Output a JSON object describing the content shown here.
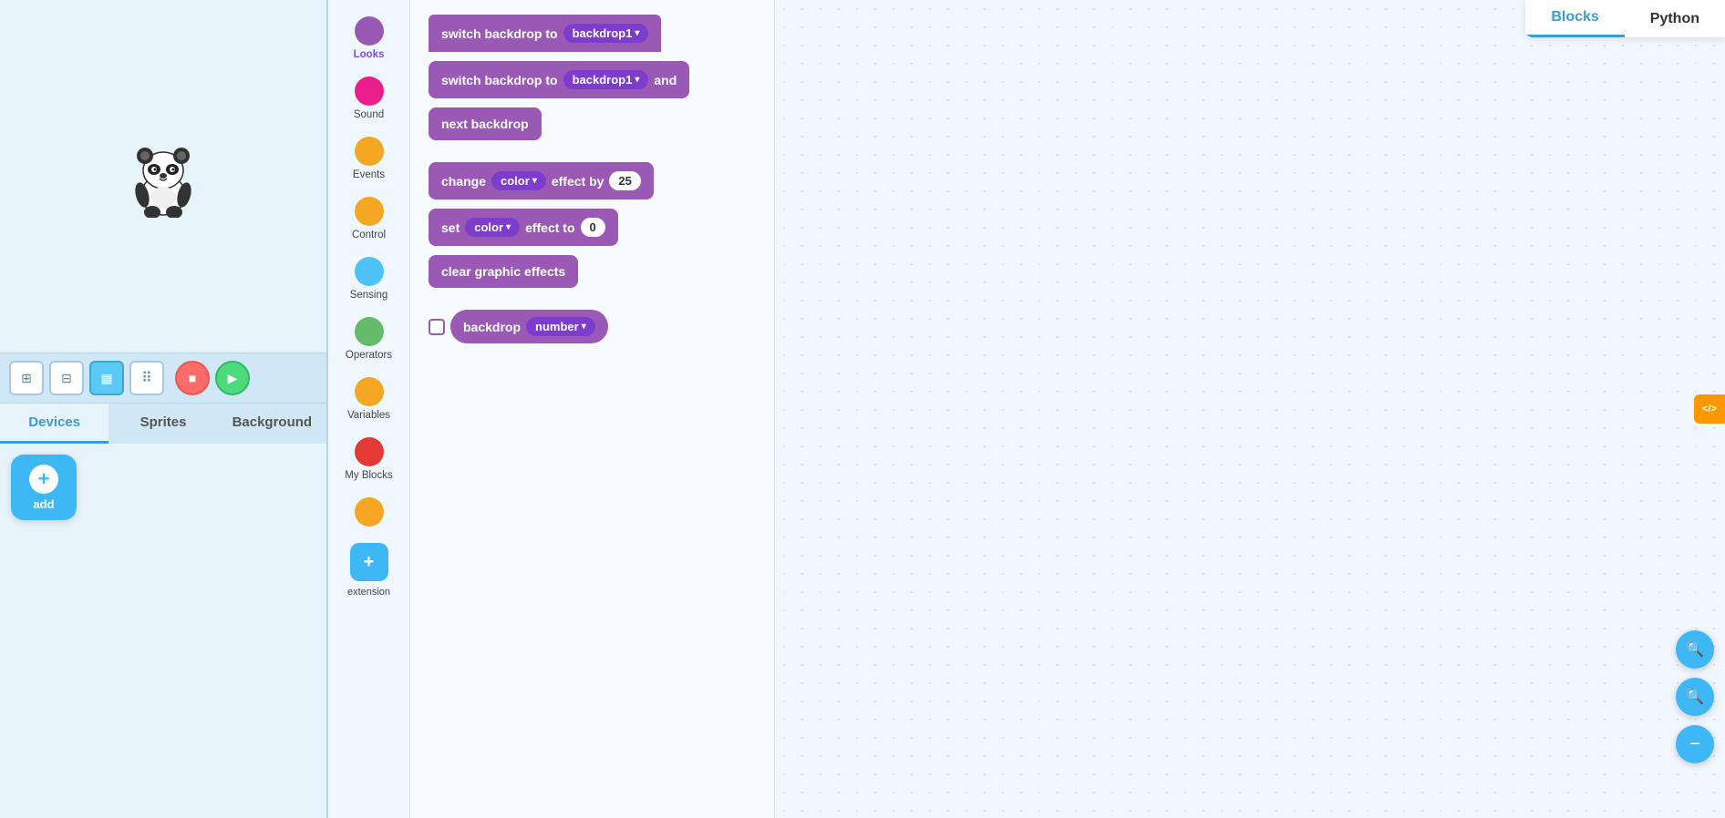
{
  "leftPanel": {
    "tabs": [
      {
        "id": "devices",
        "label": "Devices",
        "active": true
      },
      {
        "id": "sprites",
        "label": "Sprites"
      },
      {
        "id": "background",
        "label": "Background"
      }
    ],
    "addLabel": "add"
  },
  "controls": {
    "expandIcon": "⊞",
    "shrinkIcon": "⊟",
    "gridIcon": "▦",
    "menuIcon": "⋮⋮",
    "stopLabel": "■",
    "goLabel": "▶"
  },
  "sidebar": {
    "categories": [
      {
        "id": "looks",
        "label": "Looks",
        "color": "#9b59b6",
        "active": true
      },
      {
        "id": "sound",
        "label": "Sound",
        "color": "#e91e8c"
      },
      {
        "id": "events",
        "label": "Events",
        "color": "#f5a623"
      },
      {
        "id": "control",
        "label": "Control",
        "color": "#f5a623"
      },
      {
        "id": "sensing",
        "label": "Sensing",
        "color": "#4fc3f7"
      },
      {
        "id": "operators",
        "label": "Operators",
        "color": "#66bb6a"
      },
      {
        "id": "variables",
        "label": "Variables",
        "color": "#f5a623"
      },
      {
        "id": "myblocks",
        "label": "My Blocks",
        "color": "#e53935"
      },
      {
        "id": "extra1",
        "label": "",
        "color": "#f5a623"
      },
      {
        "id": "extension",
        "label": "extension",
        "color": "#3db8f5",
        "isBtn": true
      }
    ]
  },
  "blocks": [
    {
      "id": "switchBackdrop1",
      "type": "statement",
      "color": "purple",
      "parts": [
        "switch backdrop to"
      ],
      "dropdown": "backdrop1"
    },
    {
      "id": "switchBackdropAndWait",
      "type": "statement",
      "color": "purple",
      "parts": [
        "switch backdrop to"
      ],
      "dropdown": "backdrop1",
      "extra": "and"
    },
    {
      "id": "nextBackdrop",
      "type": "statement",
      "color": "purple",
      "parts": [
        "next backdrop"
      ]
    },
    {
      "id": "changeColorEffect",
      "type": "statement",
      "color": "purple",
      "parts": [
        "change",
        "effect by"
      ],
      "colorDropdown": "color",
      "value": "25"
    },
    {
      "id": "setColorEffect",
      "type": "statement",
      "color": "purple",
      "parts": [
        "set",
        "effect to"
      ],
      "colorDropdown": "color",
      "value": "0"
    },
    {
      "id": "clearGraphicEffects",
      "type": "statement",
      "color": "purple",
      "parts": [
        "clear graphic effects"
      ]
    },
    {
      "id": "backdropNumber",
      "type": "reporter",
      "color": "purple",
      "parts": [
        "backdrop"
      ],
      "dropdown": "number"
    }
  ],
  "topBar": {
    "blocksLabel": "Blocks",
    "pythonLabel": "Python",
    "activeTab": "Blocks",
    "codeToggle": "</>"
  },
  "canvas": {
    "zoomInIcon": "🔍",
    "zoomOutIcon": "🔍",
    "minusIcon": "−"
  }
}
